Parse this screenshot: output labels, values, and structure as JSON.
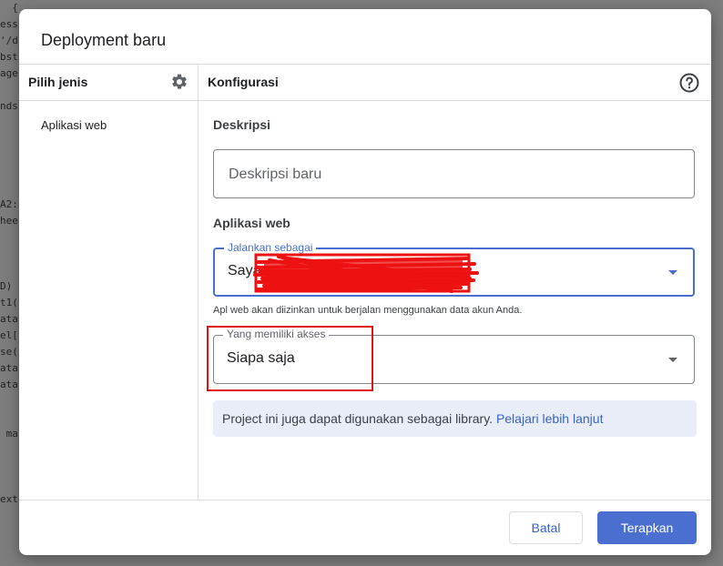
{
  "background_code": {
    "lines": [
      "  {",
      "ess",
      "'/d",
      "bst",
      "age",
      "",
      "nds",
      "",
      "",
      "",
      "",
      "",
      "A2:",
      "hee",
      "",
      "",
      "",
      "D)",
      "t1(",
      "ata",
      "el[",
      "se(",
      "ata",
      "ata",
      "",
      "",
      " ma",
      "",
      "",
      "",
      "ext"
    ]
  },
  "dialog": {
    "title": "Deployment baru"
  },
  "left_panel": {
    "header": "Pilih jenis",
    "settings_icon": "gear-icon",
    "items": [
      "Aplikasi web"
    ]
  },
  "right_panel": {
    "header": "Konfigurasi",
    "help_icon": "help-circle-icon",
    "description_section": {
      "title": "Deskripsi",
      "placeholder": "Deskripsi baru",
      "value": ""
    },
    "webapp_section": {
      "title": "Aplikasi web",
      "execute_as": {
        "label": "Jalankan sebagai",
        "value": "Saya"
      },
      "execute_helper": "Apl web akan diizinkan untuk berjalan menggunakan data akun Anda.",
      "access": {
        "label": "Yang memiliki akses",
        "value": "Siapa saja"
      }
    },
    "info": {
      "text": "Project ini juga dapat digunakan sebagai library.",
      "link": "Pelajari lebih lanjut"
    }
  },
  "footer": {
    "cancel_label": "Batal",
    "apply_label": "Terapkan"
  },
  "colors": {
    "primary": "#4a6fd0",
    "info_bg": "#e8edf8",
    "annotation_red": "#e01414"
  }
}
